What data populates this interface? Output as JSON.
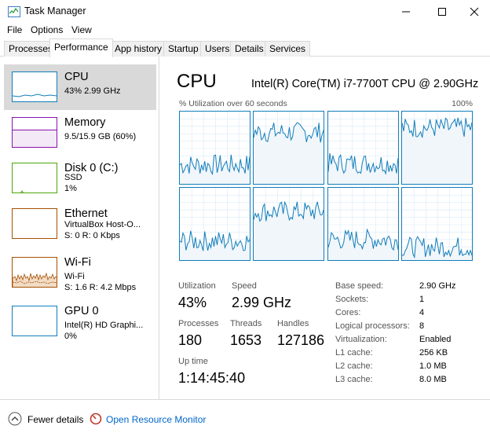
{
  "window": {
    "title": "Task Manager"
  },
  "menu": [
    "File",
    "Options",
    "View"
  ],
  "tabs": [
    "Processes",
    "Performance",
    "App history",
    "Startup",
    "Users",
    "Details",
    "Services"
  ],
  "resources": [
    {
      "name": "CPU",
      "line1": "43%  2.99 GHz",
      "line2": ""
    },
    {
      "name": "Memory",
      "line1": "9.5/15.9 GB (60%)",
      "line2": ""
    },
    {
      "name": "Disk 0 (C:)",
      "line1": "SSD",
      "line2": "1%"
    },
    {
      "name": "Ethernet",
      "line1": "VirtualBox Host-O...",
      "line2": "S: 0  R: 0 Kbps"
    },
    {
      "name": "Wi-Fi",
      "line1": "Wi-Fi",
      "line2": "S: 1.6  R: 4.2 Mbps"
    },
    {
      "name": "GPU 0",
      "line1": "Intel(R) HD Graphi...",
      "line2": "0%"
    }
  ],
  "colors": {
    "cpu": "#117dbb",
    "memory": "#8b12ae",
    "disk": "#4da60c",
    "ethernet": "#a74f01",
    "wifi": "#a74f01",
    "gpu": "#117dbb",
    "selected": "#d9d9d9"
  },
  "cpu_panel": {
    "title": "CPU",
    "model": "Intel(R) Core(TM) i7-7700T CPU @ 2.90GHz",
    "graph_label": "% Utilization over 60 seconds",
    "graph_max": "100%",
    "stats": {
      "utilization_label": "Utilization",
      "utilization": "43%",
      "speed_label": "Speed",
      "speed": "2.99 GHz",
      "processes_label": "Processes",
      "processes": "180",
      "threads_label": "Threads",
      "threads": "1653",
      "handles_label": "Handles",
      "handles": "127186",
      "uptime_label": "Up time",
      "uptime": "1:14:45:40"
    },
    "specs": [
      {
        "label": "Base speed:",
        "value": "2.90 GHz"
      },
      {
        "label": "Sockets:",
        "value": "1"
      },
      {
        "label": "Cores:",
        "value": "4"
      },
      {
        "label": "Logical processors:",
        "value": "8"
      },
      {
        "label": "Virtualization:",
        "value": "Enabled"
      },
      {
        "label": "L1 cache:",
        "value": "256 KB"
      },
      {
        "label": "L2 cache:",
        "value": "1.0 MB"
      },
      {
        "label": "L3 cache:",
        "value": "8.0 MB"
      }
    ]
  },
  "footer": {
    "fewer_details": "Fewer details",
    "resource_monitor": "Open Resource Monitor"
  }
}
